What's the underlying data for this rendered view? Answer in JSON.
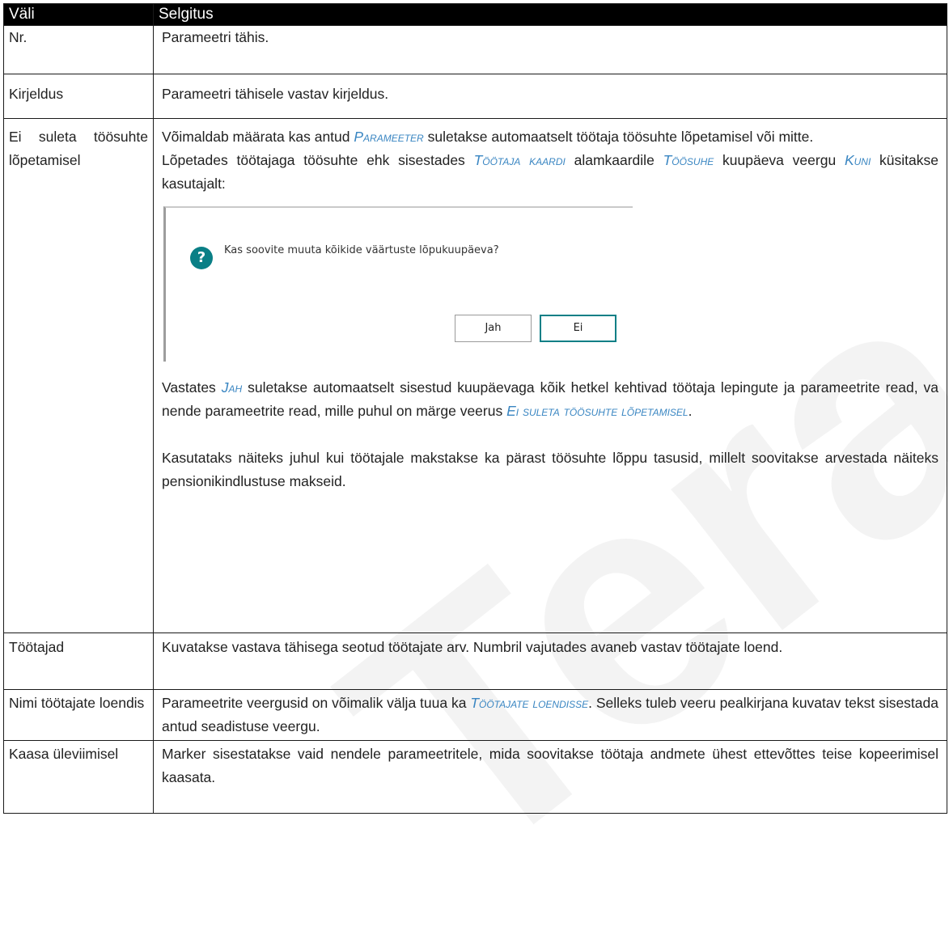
{
  "watermark": "Tera AS",
  "table": {
    "headers": [
      "Väli",
      "Selgitus"
    ],
    "rows": {
      "nr": {
        "field": "Nr.",
        "desc": "Parameetri tähis."
      },
      "kirjeldus": {
        "field": "Kirjeldus",
        "desc": "Parameetri tähisele vastav kirjeldus."
      },
      "ei_suleta": {
        "field": "Ei suleta töösuhte lõpetamisel",
        "p1_a": "Võimaldab määrata kas antud ",
        "p1_link": "Parameeter",
        "p1_b": " suletakse automaatselt töötaja töösuhte lõpetamisel või mitte.",
        "p2_a": "Lõpetades töötajaga töösuhte ehk sisestades ",
        "p2_link1": "Töötaja kaardi",
        "p2_b": " alamkaardile ",
        "p2_link2": "Töösuhe",
        "p2_c": " kuupäeva veergu ",
        "p2_link3": "Kuni",
        "p2_d": " küsitakse kasutajalt:",
        "dialog": {
          "icon": "?",
          "question": "Kas soovite muuta kõikide väärtuste lõpukuupäeva?",
          "yes": "Jah",
          "no": "Ei"
        },
        "p3_a": "Vastates ",
        "p3_link1": "Jah",
        "p3_b": " suletakse automaatselt sisestud kuupäevaga kõik hetkel kehtivad töötaja lepingute ja parameetrite read, va nende parameetrite read, mille puhul on märge veerus ",
        "p3_link2": "Ei suleta töösuhte lõpetamisel",
        "p3_c": ".",
        "p4": "Kasutataks näiteks juhul kui töötajale makstakse ka pärast töösuhte lõppu tasusid, millelt soovitakse arvestada näiteks pensionikindlustuse makseid."
      },
      "tootajad": {
        "field": "Töötajad",
        "desc": "Kuvatakse vastava tähisega seotud töötajate arv. Numbril vajutades avaneb vastav töötajate loend."
      },
      "nimi": {
        "field": "Nimi töötajate loendis",
        "desc_a": "Parameetrite veergusid on võimalik välja tuua ka ",
        "desc_link": "Töötajate loendisse",
        "desc_b": ". Selleks tuleb veeru pealkirjana kuvatav tekst sisestada antud seadistuse veergu."
      },
      "kaasa": {
        "field": "Kaasa üleviimisel",
        "desc": "Marker sisestatakse vaid nendele parameetritele, mida soovitakse töötaja andmete ühest ettevõttes teise kopeerimisel kaasata."
      }
    }
  },
  "colors": {
    "header_bg": "#000000",
    "link": "#3a86c2",
    "dialog_accent": "#0a7f86"
  }
}
